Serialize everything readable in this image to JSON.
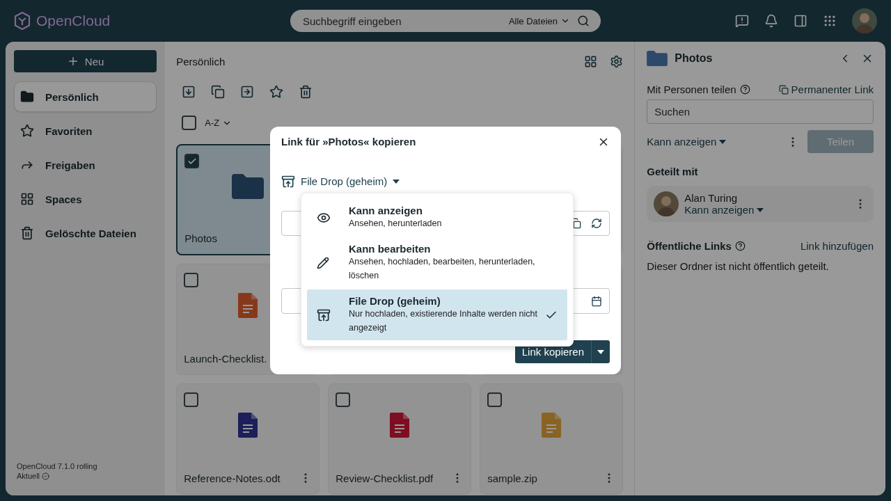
{
  "header": {
    "logo": "OpenCloud",
    "search": {
      "placeholder": "Suchbegriff eingeben",
      "scope": "Alle Dateien"
    }
  },
  "sidebar": {
    "new_button": "Neu",
    "items": [
      {
        "label": "Persönlich",
        "selected": true
      },
      {
        "label": "Favoriten",
        "selected": false
      },
      {
        "label": "Freigaben",
        "selected": false
      },
      {
        "label": "Spaces",
        "selected": false
      },
      {
        "label": "Gelöschte Dateien",
        "selected": false
      }
    ],
    "version": "OpenCloud 7.1.0 rolling",
    "status": "Aktuell"
  },
  "files": {
    "breadcrumb": "Persönlich",
    "all_selected": false,
    "sort": "A-Z",
    "items": [
      {
        "kind": "folder",
        "name": "Photos",
        "selected": true
      },
      {
        "kind": "blank"
      },
      {
        "kind": "blank"
      },
      {
        "kind": "presentation",
        "name": "Launch-Checklist.",
        "selected": false
      },
      {
        "kind": "blank"
      },
      {
        "kind": "blank"
      },
      {
        "kind": "document",
        "name": "Reference-Notes.odt",
        "selected": false,
        "more_button": true
      },
      {
        "kind": "pdf",
        "name": "Review-Checklist.pdf",
        "selected": false,
        "more_button": true
      },
      {
        "kind": "archive",
        "name": "sample.zip",
        "selected": false,
        "more_button": true
      }
    ]
  },
  "details": {
    "title": "Photos",
    "share_label": "Mit Personen teilen",
    "permalink": "Permanenter Link",
    "search_placeholder": "Suchen",
    "role": "Kann anzeigen",
    "share_button": "Teilen",
    "shared_with_title": "Geteilt mit",
    "shares": [
      {
        "name": "Alan Turing",
        "role": "Kann anzeigen"
      }
    ],
    "public_links_title": "Öffentliche Links",
    "add_link": "Link hinzufügen",
    "empty": "Dieser Ordner ist nicht öffentlich geteilt."
  },
  "modal": {
    "title": "Link für »Photos« kopieren",
    "role": "File Drop (geheim)",
    "copy_button": "Link kopieren",
    "options": [
      {
        "kind": "view",
        "title": "Kann anzeigen",
        "description": "Ansehen, herunterladen",
        "selected": false
      },
      {
        "kind": "edit",
        "title": "Kann bearbeiten",
        "description": "Ansehen, hochladen, bearbeiten, herunterladen, löschen",
        "selected": false
      },
      {
        "kind": "upload",
        "title": "File Drop (geheim)",
        "description": "Nur hochladen, existierende Inhalte werden nicht angezeigt",
        "selected": true
      }
    ]
  }
}
